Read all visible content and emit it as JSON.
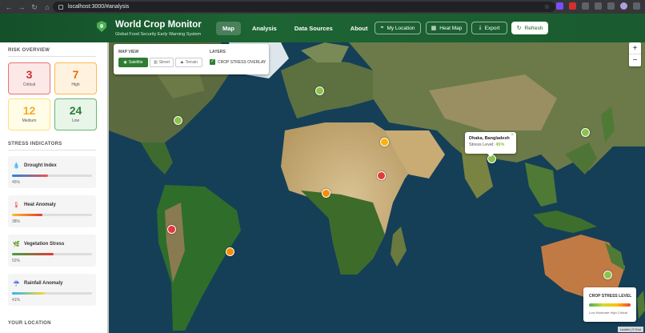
{
  "browser": {
    "url": "localhost:3000/#analysis"
  },
  "header": {
    "title": "World Crop Monitor",
    "subtitle": "Global Food Security Early Warning System",
    "nav": [
      "Map",
      "Analysis",
      "Data Sources",
      "About"
    ],
    "buttons": {
      "location": "My Location",
      "heatmap": "Heat Map",
      "export": "Export",
      "refresh": "Refresh"
    }
  },
  "sidebar": {
    "risk_title": "RISK OVERVIEW",
    "risk": [
      {
        "count": "3",
        "label": "Critical",
        "color": "#d32f2f",
        "bg": "#fde8e8",
        "border": "#e57373"
      },
      {
        "count": "7",
        "label": "High",
        "color": "#ef6c00",
        "bg": "#fff3e0",
        "border": "#ffb74d"
      },
      {
        "count": "12",
        "label": "Medium",
        "color": "#f9a825",
        "bg": "#fffde7",
        "border": "#ffe082"
      },
      {
        "count": "24",
        "label": "Low",
        "color": "#2e7d32",
        "bg": "#e8f5e9",
        "border": "#66bb6a"
      }
    ],
    "stress_title": "STRESS INDICATORS",
    "indicators": [
      {
        "name": "Drought Index",
        "value": "45%",
        "fraction": 0.45,
        "icon": "droplet-icon",
        "gradient": "linear-gradient(90deg,#1e88e5,#ef5350)"
      },
      {
        "name": "Heat Anomaly",
        "value": "38%",
        "fraction": 0.38,
        "icon": "thermometer-icon",
        "gradient": "linear-gradient(90deg,#fbc02d,#e53935)"
      },
      {
        "name": "Vegetation Stress",
        "value": "52%",
        "fraction": 0.52,
        "icon": "leaf-icon",
        "gradient": "linear-gradient(90deg,#43a047,#e53935)"
      },
      {
        "name": "Rainfall Anomaly",
        "value": "41%",
        "fraction": 0.41,
        "icon": "rain-icon",
        "gradient": "linear-gradient(90deg,#29b6f6,#fdd835)"
      }
    ],
    "location_title": "YOUR LOCATION"
  },
  "map": {
    "view_title": "MAP VIEW",
    "layers_title": "LAYERS",
    "views": [
      "Satellite",
      "Street",
      "Terrain"
    ],
    "layer_label": "CROP STRESS OVERLAY",
    "zoom_in": "+",
    "zoom_out": "−",
    "popup": {
      "title": "Dhaka, Bangladesh",
      "stress_label": "Stress Level:",
      "stress_value": "45%"
    },
    "legend": {
      "title": "CROP STRESS LEVEL",
      "labels": "Low  Moderate  High  Critical"
    },
    "attribution": "Leaflet | © Esri"
  }
}
